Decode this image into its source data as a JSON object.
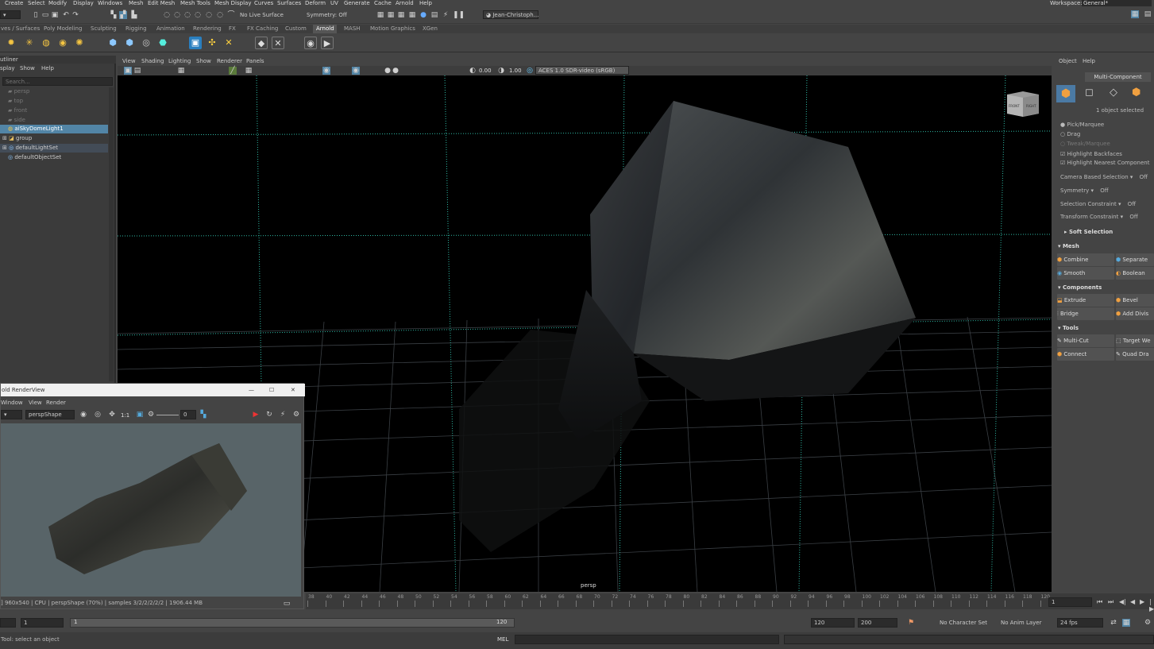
{
  "menus": [
    "Create",
    "Select",
    "Modify",
    "Display",
    "Windows",
    "Mesh",
    "Edit Mesh",
    "Mesh Tools",
    "Mesh Display",
    "Curves",
    "Surfaces",
    "Deform",
    "UV",
    "Generate",
    "Cache",
    "Arnold",
    "Help"
  ],
  "workspace": {
    "label": "Workspace:",
    "value": "General*"
  },
  "status": {
    "live_surface": "No Live Surface",
    "symmetry": "Symmetry: Off",
    "user": "Jean-Christoph..."
  },
  "shelf_tabs": [
    "ves / Surfaces",
    "Poly Modeling",
    "Sculpting",
    "Rigging",
    "Animation",
    "Rendering",
    "FX",
    "FX Caching",
    "Custom",
    "Arnold",
    "MASH",
    "Motion Graphics",
    "XGen"
  ],
  "active_shelf_tab": "Arnold",
  "outliner": {
    "title": "utliner",
    "menu": [
      "splay",
      "Show",
      "Help"
    ],
    "search_placeholder": "Search...",
    "items": [
      {
        "label": "persp",
        "dim": true
      },
      {
        "label": "top",
        "dim": true
      },
      {
        "label": "front",
        "dim": true
      },
      {
        "label": "side",
        "dim": true
      },
      {
        "label": "aiSkyDomeLight1",
        "selected": true
      },
      {
        "label": "group"
      },
      {
        "label": "defaultLightSet",
        "highlight": true
      },
      {
        "label": "defaultObjectSet"
      }
    ]
  },
  "viewport": {
    "menu": [
      "View",
      "Shading",
      "Lighting",
      "Show",
      "Renderer",
      "Panels"
    ],
    "exposure": "0.00",
    "gamma": "1.00",
    "colorspace": "ACES 1.0 SDR-video (sRGB)",
    "camera_label": "persp",
    "viewcube": [
      "FRONT",
      "RIGHT"
    ]
  },
  "render_view": {
    "title": "old RenderView",
    "menu": [
      "Window",
      "View",
      "Render"
    ],
    "camera": "perspShape",
    "ratio": "1:1",
    "value": "0",
    "status": "] 960x540 | CPU | perspShape (70%) | samples 3/2/2/2/2/2 | 1906.44 MB"
  },
  "modeling_toolkit": {
    "tabs": [
      "Object",
      "Help"
    ],
    "mode": "Multi-Component",
    "selection_info": "1 object selected",
    "options": [
      {
        "label": "Pick/Marquee",
        "type": "radio",
        "on": true
      },
      {
        "label": "Drag",
        "type": "radio",
        "on": false
      },
      {
        "label": "Tweak/Marquee",
        "type": "radio",
        "on": false,
        "dim": true
      },
      {
        "label": "Highlight Backfaces",
        "type": "check",
        "on": true
      },
      {
        "label": "Highlight Nearest Component",
        "type": "check",
        "on": true
      }
    ],
    "settings": [
      {
        "label": "Camera Based Selection",
        "value": "Off"
      },
      {
        "label": "Symmetry",
        "value": "Off"
      },
      {
        "label": "Selection Constraint",
        "value": "Off"
      },
      {
        "label": "Transform Constraint",
        "value": "Off"
      }
    ],
    "soft_selection": "Soft Selection",
    "sections": [
      {
        "title": "Mesh",
        "buttons": [
          "Combine",
          "Separate",
          "Smooth",
          "Boolean"
        ]
      },
      {
        "title": "Components",
        "buttons": [
          "Extrude",
          "Bevel",
          "Bridge",
          "Add Divis"
        ]
      },
      {
        "title": "Tools",
        "buttons": [
          "Multi-Cut",
          "Target We",
          "Connect",
          "Quad Dra"
        ]
      }
    ]
  },
  "timeline": {
    "ticks": [
      "38",
      "40",
      "42",
      "44",
      "46",
      "48",
      "50",
      "52",
      "54",
      "56",
      "58",
      "60",
      "62",
      "64",
      "66",
      "68",
      "70",
      "72",
      "74",
      "76",
      "78",
      "80",
      "82",
      "84",
      "86",
      "88",
      "90",
      "92",
      "94",
      "96",
      "98",
      "100",
      "102",
      "104",
      "106",
      "108",
      "110",
      "112",
      "114",
      "116",
      "118",
      "120"
    ],
    "current_frame": "1"
  },
  "range": {
    "start": "1",
    "slider_start": "1",
    "slider_end": "120",
    "end": "120",
    "max": "200",
    "character_set": "No Character Set",
    "anim_layer": "No Anim Layer",
    "fps": "24 fps"
  },
  "command": {
    "lang": "MEL",
    "help": "Tool: select an object"
  },
  "colors": {
    "selection": "#5285a6",
    "grid_axis": "#2fb8a4",
    "bg": "#444444"
  }
}
